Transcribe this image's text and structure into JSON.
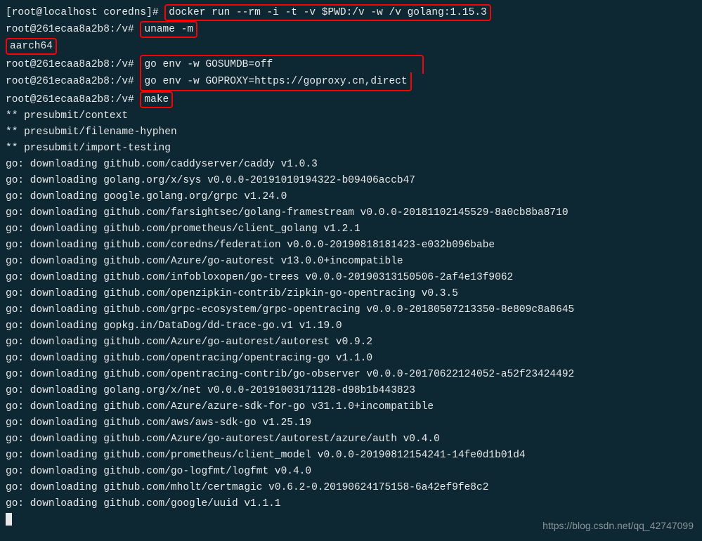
{
  "prompts": {
    "host": "[root@localhost coredns]#",
    "container": "root@261ecaa8a2b8:/v#"
  },
  "commands": {
    "docker": "docker run --rm -i -t -v $PWD:/v -w /v golang:1.15.3",
    "uname": "uname -m",
    "uname_output": "aarch64",
    "goenv1": "go env -w GOSUMDB=off",
    "goenv2": "go env -w GOPROXY=https://goproxy.cn,direct",
    "make": "make"
  },
  "presubmit": [
    "** presubmit/context",
    "** presubmit/filename-hyphen",
    "** presubmit/import-testing"
  ],
  "downloads": [
    "go: downloading github.com/caddyserver/caddy v1.0.3",
    "go: downloading golang.org/x/sys v0.0.0-20191010194322-b09406accb47",
    "go: downloading google.golang.org/grpc v1.24.0",
    "go: downloading github.com/farsightsec/golang-framestream v0.0.0-20181102145529-8a0cb8ba8710",
    "go: downloading github.com/prometheus/client_golang v1.2.1",
    "go: downloading github.com/coredns/federation v0.0.0-20190818181423-e032b096babe",
    "go: downloading github.com/Azure/go-autorest v13.0.0+incompatible",
    "go: downloading github.com/infobloxopen/go-trees v0.0.0-20190313150506-2af4e13f9062",
    "go: downloading github.com/openzipkin-contrib/zipkin-go-opentracing v0.3.5",
    "go: downloading github.com/grpc-ecosystem/grpc-opentracing v0.0.0-20180507213350-8e809c8a8645",
    "go: downloading gopkg.in/DataDog/dd-trace-go.v1 v1.19.0",
    "go: downloading github.com/Azure/go-autorest/autorest v0.9.2",
    "go: downloading github.com/opentracing/opentracing-go v1.1.0",
    "go: downloading github.com/opentracing-contrib/go-observer v0.0.0-20170622124052-a52f23424492",
    "go: downloading golang.org/x/net v0.0.0-20191003171128-d98b1b443823",
    "go: downloading github.com/Azure/azure-sdk-for-go v31.1.0+incompatible",
    "go: downloading github.com/aws/aws-sdk-go v1.25.19",
    "go: downloading github.com/Azure/go-autorest/autorest/azure/auth v0.4.0",
    "go: downloading github.com/prometheus/client_model v0.0.0-20190812154241-14fe0d1b01d4",
    "go: downloading github.com/go-logfmt/logfmt v0.4.0",
    "go: downloading github.com/mholt/certmagic v0.6.2-0.20190624175158-6a42ef9fe8c2",
    "go: downloading github.com/google/uuid v1.1.1"
  ],
  "watermark": "https://blog.csdn.net/qq_42747099"
}
